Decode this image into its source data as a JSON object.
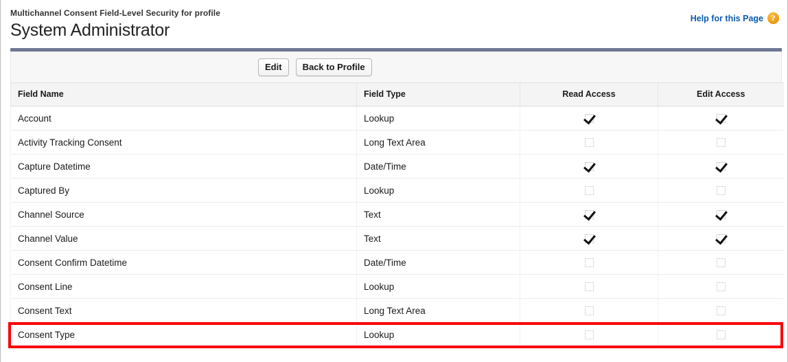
{
  "header": {
    "eyebrow": "Multichannel Consent Field-Level Security for profile",
    "title": "System Administrator",
    "help_link_label": "Help for this Page",
    "help_icon": "help-question-icon",
    "help_icon_glyph": "?",
    "help_link_color": "#0b5cab",
    "accent_bar_color": "#6d7792"
  },
  "toolbar": {
    "edit_label": "Edit",
    "back_to_profile_label": "Back to Profile"
  },
  "table": {
    "columns": [
      {
        "key": "field_name",
        "label": "Field Name",
        "align": "left"
      },
      {
        "key": "field_type",
        "label": "Field Type",
        "align": "left"
      },
      {
        "key": "read_access",
        "label": "Read Access",
        "align": "center"
      },
      {
        "key": "edit_access",
        "label": "Edit Access",
        "align": "center"
      }
    ],
    "rows": [
      {
        "field_name": "Account",
        "field_type": "Lookup",
        "read_access": true,
        "edit_access": true,
        "highlighted": false
      },
      {
        "field_name": "Activity Tracking Consent",
        "field_type": "Long Text Area",
        "read_access": false,
        "edit_access": false,
        "highlighted": false
      },
      {
        "field_name": "Capture Datetime",
        "field_type": "Date/Time",
        "read_access": true,
        "edit_access": true,
        "highlighted": false
      },
      {
        "field_name": "Captured By",
        "field_type": "Lookup",
        "read_access": false,
        "edit_access": false,
        "highlighted": false
      },
      {
        "field_name": "Channel Source",
        "field_type": "Text",
        "read_access": true,
        "edit_access": true,
        "highlighted": false
      },
      {
        "field_name": "Channel Value",
        "field_type": "Text",
        "read_access": true,
        "edit_access": true,
        "highlighted": false
      },
      {
        "field_name": "Consent Confirm Datetime",
        "field_type": "Date/Time",
        "read_access": false,
        "edit_access": false,
        "highlighted": false
      },
      {
        "field_name": "Consent Line",
        "field_type": "Lookup",
        "read_access": false,
        "edit_access": false,
        "highlighted": false
      },
      {
        "field_name": "Consent Text",
        "field_type": "Long Text Area",
        "read_access": false,
        "edit_access": false,
        "highlighted": false
      },
      {
        "field_name": "Consent Type",
        "field_type": "Lookup",
        "read_access": false,
        "edit_access": false,
        "highlighted": true
      }
    ]
  },
  "annotation": {
    "highlight_color": "#fb0007",
    "highlight_target_row": "Consent Type"
  }
}
